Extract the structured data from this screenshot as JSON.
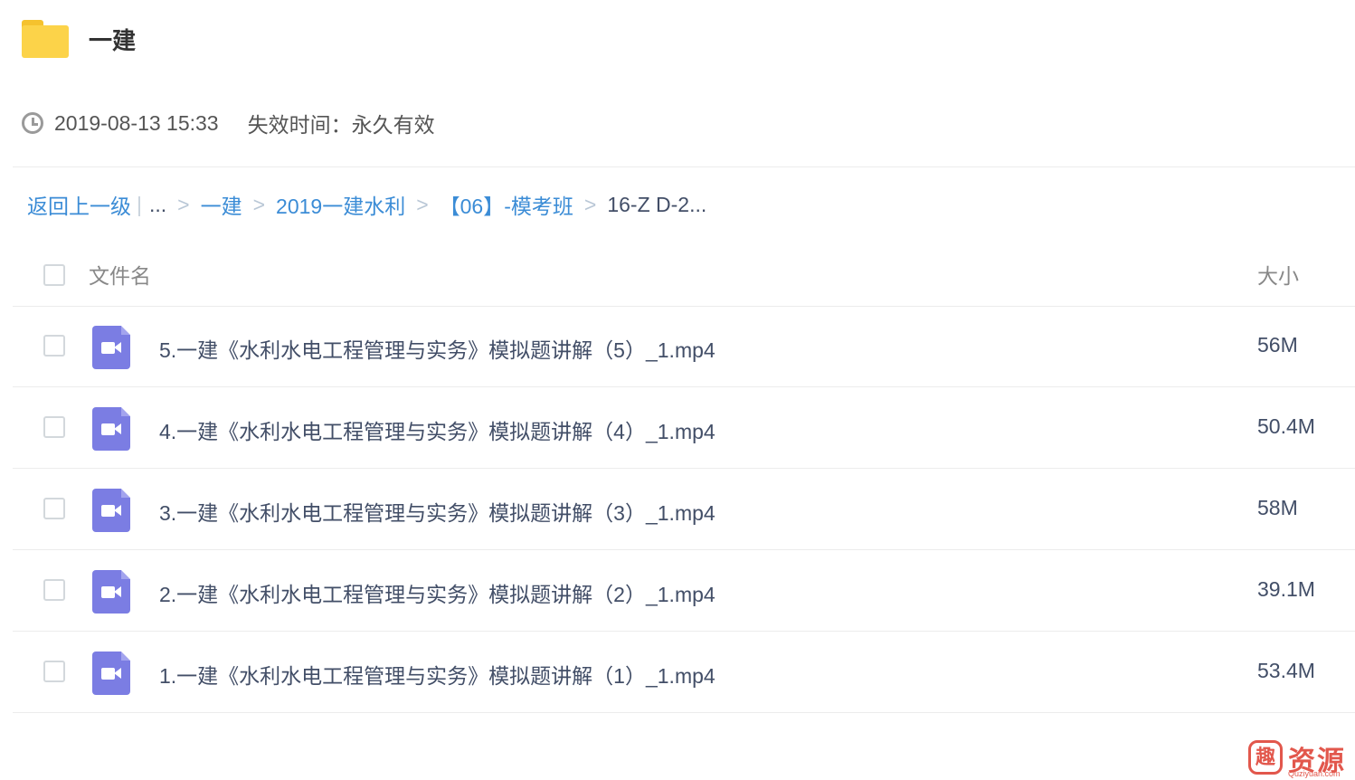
{
  "folder": {
    "icon": "folder-icon",
    "title": "一建"
  },
  "meta": {
    "icon": "clock-icon",
    "date": "2019-08-13 15:33",
    "expire_label": "失效时间：",
    "expire_value": "永久有效"
  },
  "breadcrumb": {
    "back": "返回上一级",
    "ellipsis": "...",
    "items": [
      "一建",
      "2019一建水利",
      "【06】-模考班"
    ],
    "current": "16-Z D-2...",
    "separator": ">",
    "bar": "|"
  },
  "table": {
    "headers": {
      "name": "文件名",
      "size": "大小"
    },
    "files": [
      {
        "name": "5.一建《水利水电工程管理与实务》模拟题讲解（5）_1.mp4",
        "size": "56M",
        "icon": "video-file-icon"
      },
      {
        "name": "4.一建《水利水电工程管理与实务》模拟题讲解（4）_1.mp4",
        "size": "50.4M",
        "icon": "video-file-icon"
      },
      {
        "name": "3.一建《水利水电工程管理与实务》模拟题讲解（3）_1.mp4",
        "size": "58M",
        "icon": "video-file-icon"
      },
      {
        "name": "2.一建《水利水电工程管理与实务》模拟题讲解（2）_1.mp4",
        "size": "39.1M",
        "icon": "video-file-icon"
      },
      {
        "name": "1.一建《水利水电工程管理与实务》模拟题讲解（1）_1.mp4",
        "size": "53.4M",
        "icon": "video-file-icon"
      }
    ]
  },
  "watermark": {
    "logo_char": "趣",
    "text": "资源",
    "sub": "Quziyuan.com"
  },
  "colors": {
    "link": "#3b8cd6",
    "folder": "#fcd349",
    "video_icon": "#7b7de3",
    "watermark": "#e2574c"
  }
}
